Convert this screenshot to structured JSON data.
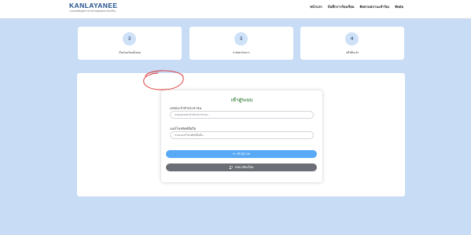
{
  "header": {
    "brand_name": "KANLAYANEE",
    "brand_subtitle": "ระบบขอข้อมูลข่าวสารส่วนบุคคลและร้องเรียน",
    "nav": [
      "หน้าแรก",
      "บันทึกการร้องเรียน",
      "ติดตามสถานะคำร้อง",
      "ติดต่อ"
    ]
  },
  "stats": [
    {
      "value": "3",
      "label": "เรื่องร้องเรียนทั้งหมด"
    },
    {
      "value": "3",
      "label": "กำลังดำเนินการ"
    },
    {
      "value": "4",
      "label": "เสร็จสิ้นแล้ว"
    }
  ],
  "login": {
    "title": "เข้าสู่ระบบ",
    "id_label": "เลขประจำตัวประชาชน",
    "id_placeholder": "กรอกเลขประจำตัวประชาชน...",
    "phone_label": "เบอร์โทรศัพท์มือถือ",
    "phone_placeholder": "กรอกเบอร์โทรศัพท์มือถือ...",
    "login_button": "เข้าสู่ระบบ",
    "register_button": "ลงทะเบียนใหม่",
    "login_icon": "login-arrow-icon",
    "register_icon": "user-plus-icon"
  },
  "colors": {
    "page_bg": "#c8dcf6",
    "brand": "#1f4f8b",
    "title_green": "#4c8a4c",
    "login_btn": "#58a9f6",
    "register_btn": "#6b6f75",
    "annotation": "#d92b2b"
  }
}
